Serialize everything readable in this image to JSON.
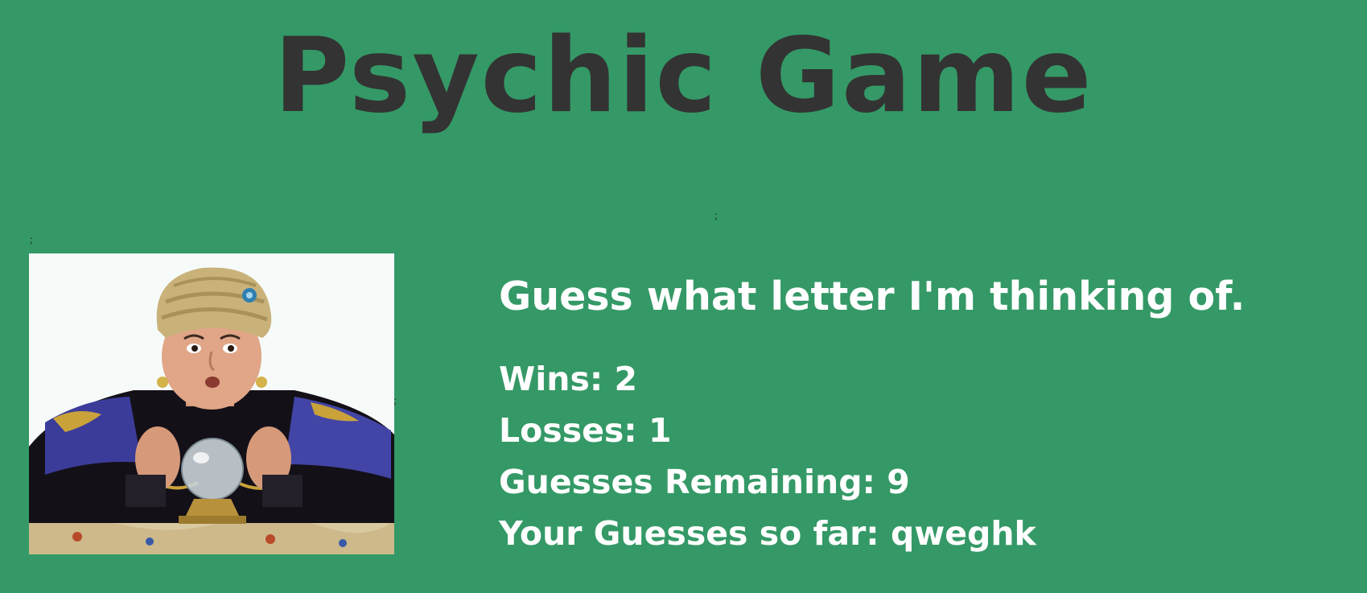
{
  "header": {
    "title": "Psychic Game"
  },
  "stray_marks": {
    "top": ";",
    "left": ";",
    "right": ";"
  },
  "image": {
    "subject": "fortune teller with turban and crystal ball"
  },
  "game": {
    "prompt": "Guess what letter I'm thinking of.",
    "wins_label": "Wins: ",
    "wins": "2",
    "losses_label": "Losses: ",
    "losses": "1",
    "remaining_label": "Guesses Remaining: ",
    "remaining": "9",
    "guesses_label": "Your Guesses so far: ",
    "guesses": "qweghk"
  },
  "colors": {
    "background": "#349966",
    "title": "#333333",
    "text": "#ffffff"
  }
}
